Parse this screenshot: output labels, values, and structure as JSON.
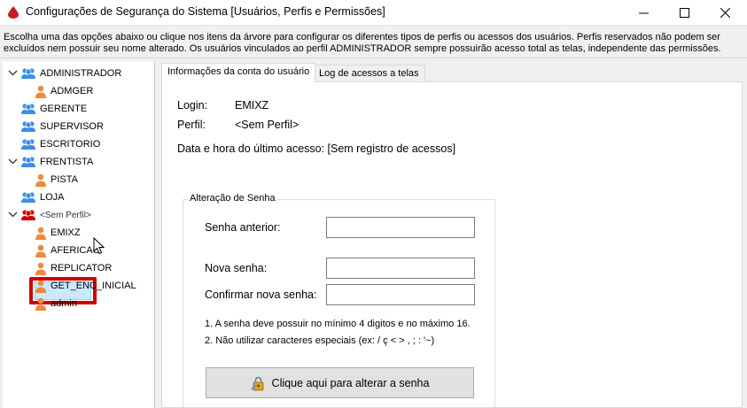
{
  "window": {
    "title": "Configurações de Segurança do Sistema [Usuários, Perfis e Permissões]"
  },
  "info": {
    "line1": "Escolha uma das opções abaixo ou clique nos itens da árvore para configurar os diferentes tipos de perfis ou acessos dos usuários. Perfis reservados não podem ser",
    "line2": "excluídos nem possuir seu nome alterado. Os usuários vinculados ao perfil ADMINISTRADOR sempre possuirão acesso total as telas, independente das permissões."
  },
  "tree": {
    "items": [
      {
        "label": "ADMINISTRADOR",
        "type": "group",
        "expanded": true
      },
      {
        "label": "ADMGER",
        "type": "user"
      },
      {
        "label": "GERENTE",
        "type": "group"
      },
      {
        "label": "SUPERVISOR",
        "type": "group"
      },
      {
        "label": "ESCRITORIO",
        "type": "group"
      },
      {
        "label": "FRENTISTA",
        "type": "group",
        "expanded": true
      },
      {
        "label": "PISTA",
        "type": "user"
      },
      {
        "label": "LOJA",
        "type": "group"
      },
      {
        "label": "<Sem Perfil>",
        "type": "group-red",
        "expanded": true
      },
      {
        "label": "EMIXZ",
        "type": "user",
        "selected": true
      },
      {
        "label": "AFERICAO",
        "type": "user"
      },
      {
        "label": "REPLICATOR",
        "type": "user"
      },
      {
        "label": "GET_ENC_INICIAL",
        "type": "user"
      },
      {
        "label": "admin",
        "type": "user"
      }
    ]
  },
  "tabs": {
    "account": "Informações da conta do usuário",
    "log": "Log de acessos a telas"
  },
  "account": {
    "login_label": "Login:",
    "login_value": "EMIXZ",
    "profile_label": "Perfil:",
    "profile_value": "<Sem Perfil>",
    "last_access": "Data e hora do último acesso: [Sem registro de acessos]"
  },
  "password": {
    "group_title": "Alteração de Senha",
    "old_label": "Senha anterior:",
    "new_label": "Nova senha:",
    "confirm_label": "Confirmar nova senha:",
    "note1": "1. A senha deve possuir no mínimo 4 digitos e no máximo 16.",
    "note2": "2. Não utilizar caracteres especiais (ex: / ç < > , ; : '~)",
    "button": "Clique aqui para alterar a senha"
  },
  "colors": {
    "group_icon": "#3b8fe6",
    "user_icon": "#f08a3c",
    "highlight": "#d10000",
    "selection": "#cce8ff"
  }
}
